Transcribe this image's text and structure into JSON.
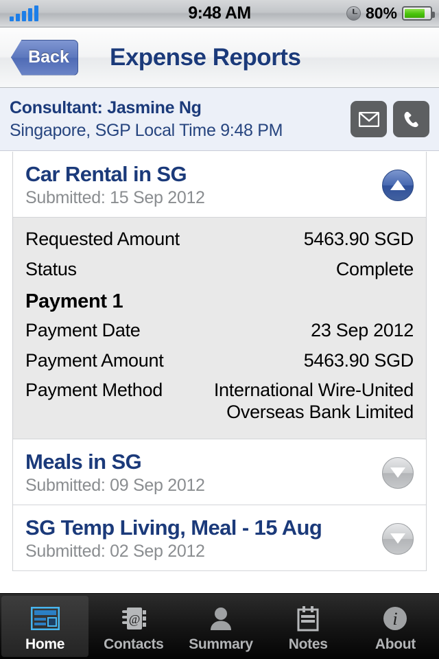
{
  "status_bar": {
    "signal_icon": "signal-bars-icon",
    "time": "9:48 AM",
    "clock_icon": "alarm-clock-icon",
    "battery_percent": "80%",
    "battery_icon": "battery-icon",
    "battery_level": 80,
    "signal_color": "#1d7ee8",
    "battery_color": "#49c40b"
  },
  "nav_bar": {
    "back_label": "Back",
    "title": "Expense Reports",
    "title_color": "#1b3a7a"
  },
  "consultant": {
    "name_line": "Consultant: Jasmine Ng",
    "location_line": "Singapore, SGP   Local Time 9:48 PM",
    "email_icon": "envelope-icon",
    "phone_icon": "phone-icon",
    "background": "#ecf0f8"
  },
  "reports": [
    {
      "title": "Car Rental in SG",
      "submitted": "Submitted: 15 Sep 2012",
      "expanded": true,
      "toggle_icon": "triangle-up-icon",
      "details": [
        {
          "label": "Requested Amount",
          "value": "5463.90 SGD"
        },
        {
          "label": "Status",
          "value": "Complete"
        }
      ],
      "payment_heading": "Payment 1",
      "payment_details": [
        {
          "label": "Payment Date",
          "value": "23 Sep 2012"
        },
        {
          "label": "Payment Amount",
          "value": "5463.90 SGD"
        },
        {
          "label": "Payment Method",
          "value": "International Wire-United Overseas Bank Limited"
        }
      ]
    },
    {
      "title": "Meals in SG",
      "submitted": "Submitted: 09 Sep 2012",
      "expanded": false,
      "toggle_icon": "triangle-down-icon"
    },
    {
      "title": "SG Temp Living, Meal - 15 Aug",
      "submitted": "Submitted: 02 Sep 2012",
      "expanded": false,
      "toggle_icon": "triangle-down-icon"
    }
  ],
  "tab_bar": {
    "items": [
      {
        "label": "Home",
        "icon": "dashboard-icon",
        "active": true
      },
      {
        "label": "Contacts",
        "icon": "address-book-icon",
        "active": false
      },
      {
        "label": "Summary",
        "icon": "person-icon",
        "active": false
      },
      {
        "label": "Notes",
        "icon": "notepad-icon",
        "active": false
      },
      {
        "label": "About",
        "icon": "info-circle-icon",
        "active": false
      }
    ]
  }
}
